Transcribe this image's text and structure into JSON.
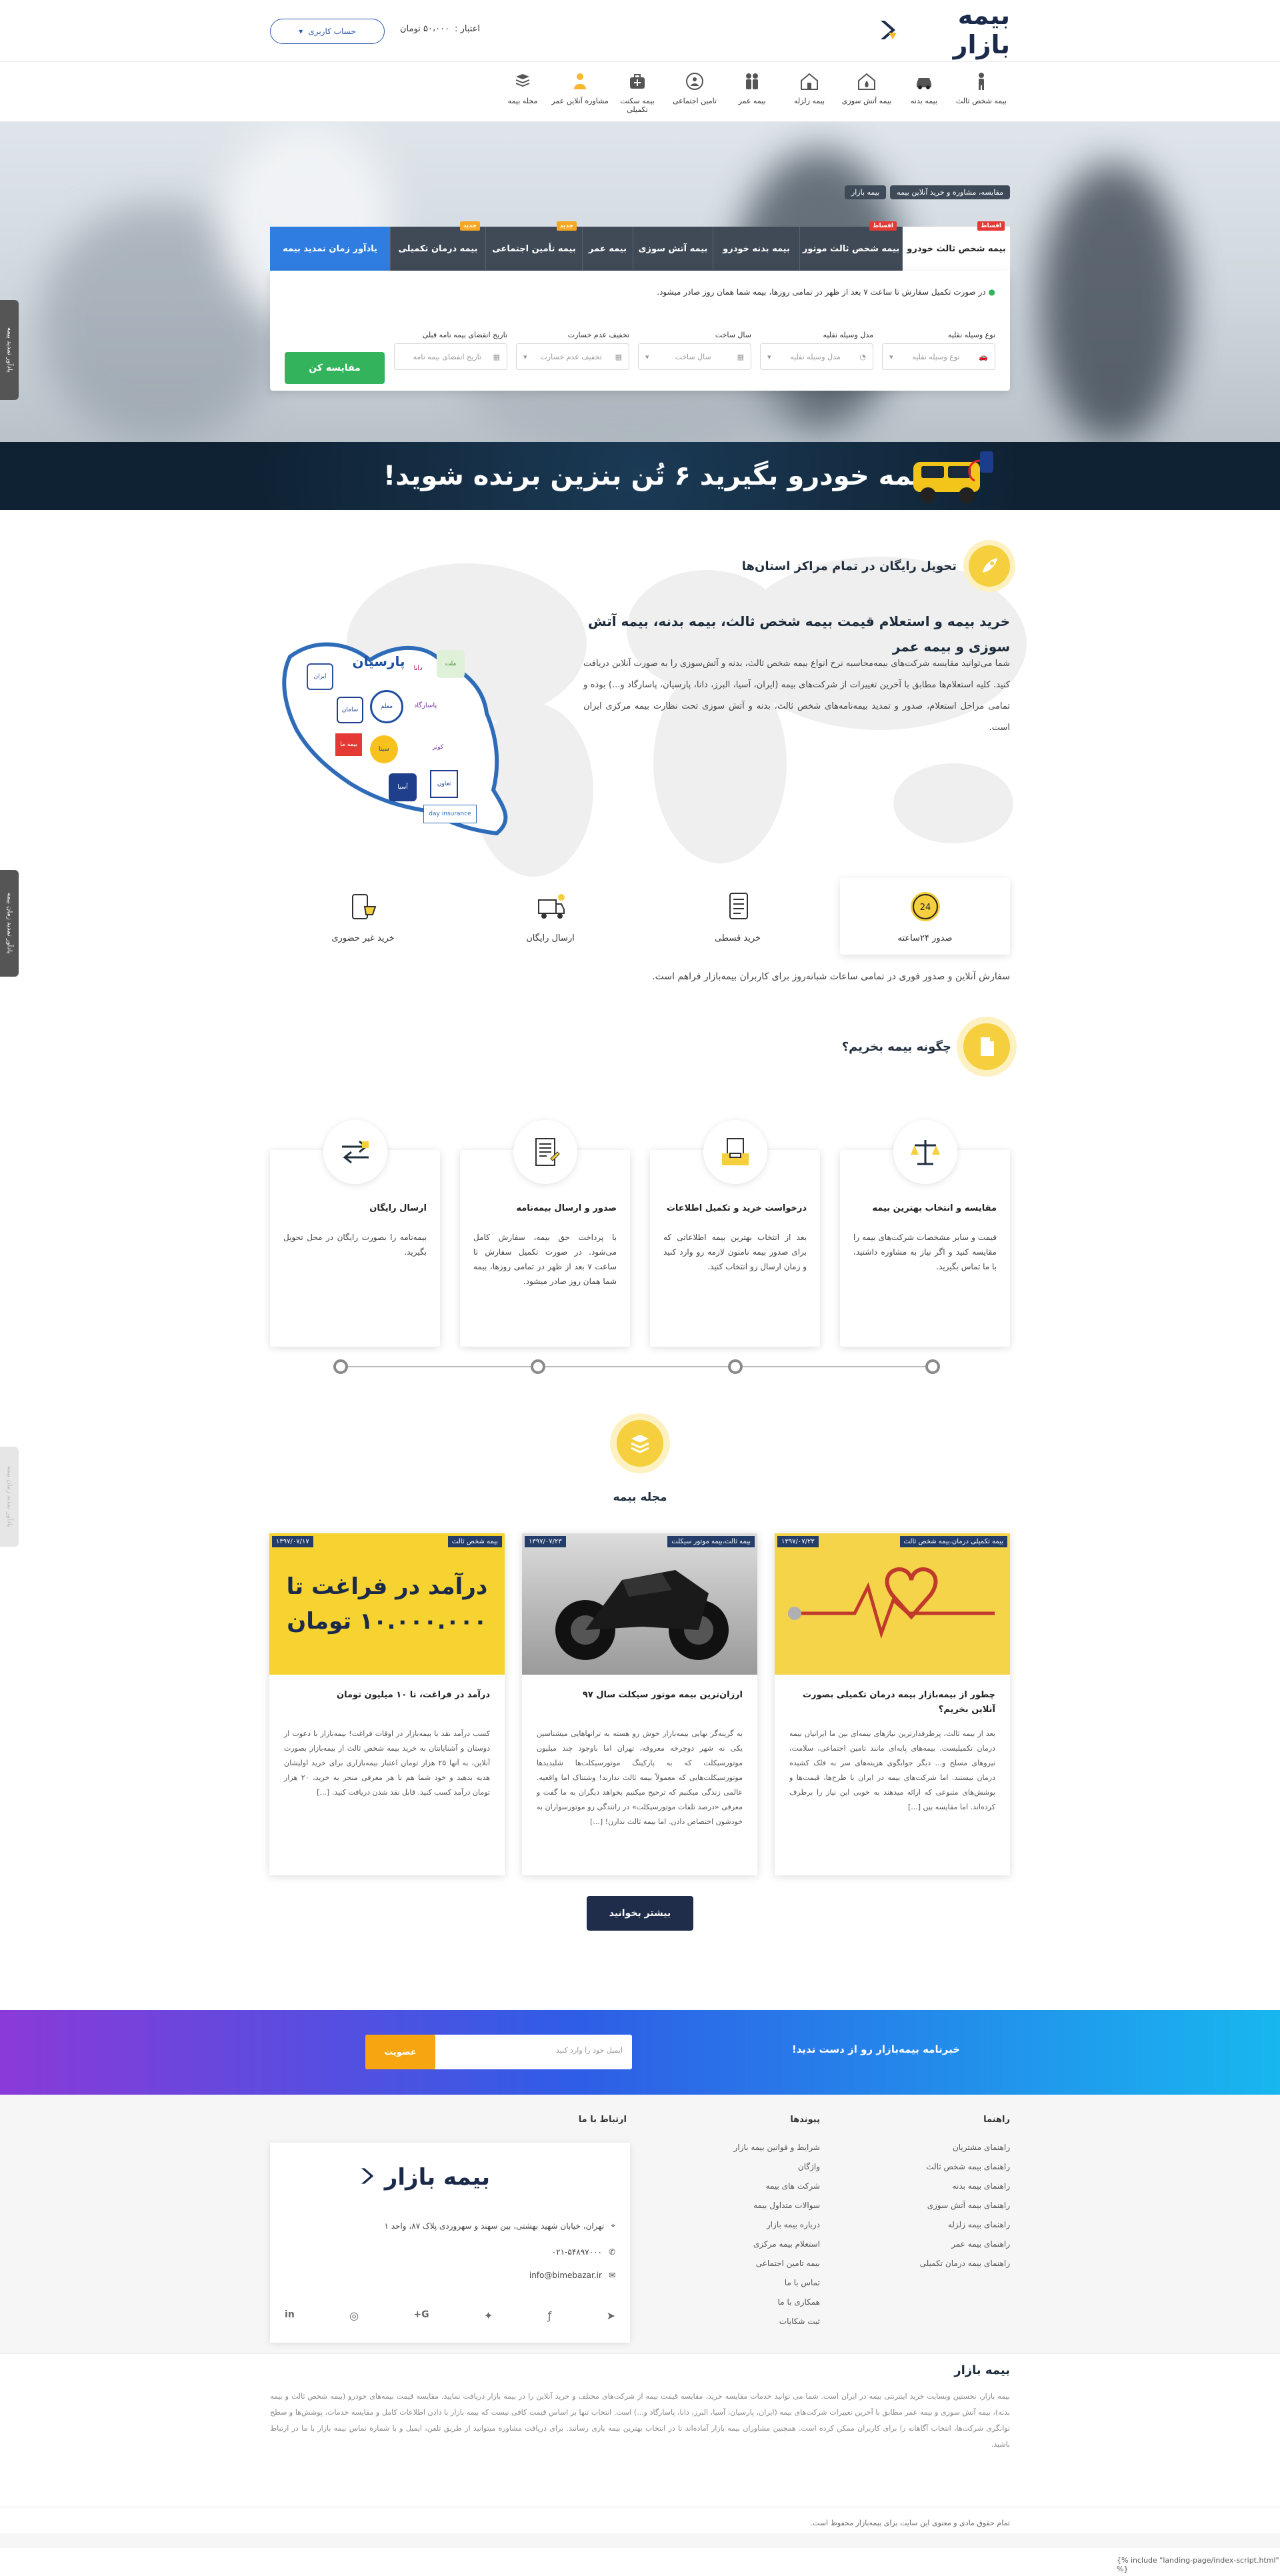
{
  "header": {
    "logo_text": "بیمه بازار",
    "account_label": "حساب کاربری",
    "credit_label": "اعتبار :",
    "credit_value": "۵۰،۰۰۰ تومان"
  },
  "nav": [
    {
      "label": "بیمه شخص ثالث",
      "icon": "person-icon"
    },
    {
      "label": "بیمه بدنه",
      "icon": "car-icon"
    },
    {
      "label": "بیمه آتش سوزی",
      "icon": "fire-home-icon"
    },
    {
      "label": "بیمه زلزله",
      "icon": "house-icon"
    },
    {
      "label": "بیمه عمر",
      "icon": "family-icon"
    },
    {
      "label": "تامین اجتماعی",
      "icon": "social-security-icon"
    },
    {
      "label": "بیمه سکنت تکمیلی",
      "icon": "medical-bag-icon"
    },
    {
      "label": "مشاوره آنلاین عمر",
      "icon": "consultant-icon"
    },
    {
      "label": "مجله بیمه",
      "icon": "magazine-icon"
    }
  ],
  "hero": {
    "breadcrumb": [
      "مقایسه، مشاوره و خرید آنلاین بیمه",
      "بیمه بازار"
    ],
    "tabs": [
      {
        "label": "بیمه شخص ثالث خودرو",
        "badge": "اقساط",
        "badge_color": "#e53935",
        "active": true
      },
      {
        "label": "بیمه شخص ثالث موتور",
        "badge": "اقساط",
        "badge_color": "#e53935"
      },
      {
        "label": "بیمه بدنه خودرو",
        "badge": ""
      },
      {
        "label": "بیمه آتش سوزی",
        "badge": ""
      },
      {
        "label": "بیمه عمر",
        "badge": ""
      },
      {
        "label": "بیمه تأمین اجتماعی",
        "badge": "جدید",
        "badge_color": "#f5a623"
      },
      {
        "label": "بیمه درمان تکمیلی",
        "badge": "جدید",
        "badge_color": "#f5a623"
      }
    ],
    "remind_tab": "یادآور زمان تمدید بیمه",
    "note": "در صورت تکمیل سفارش تا ساعت ۷ بعد از ظهر در تمامی روزها، بیمه شما همان روز صادر میشود.",
    "fields": [
      {
        "label": "نوع وسیله نقلیه",
        "placeholder": "نوع وسیله نقلیه"
      },
      {
        "label": "مدل وسیله نقلیه",
        "placeholder": "مدل وسیله نقلیه"
      },
      {
        "label": "سال ساخت",
        "placeholder": "سال ساخت"
      },
      {
        "label": "تخفیف عدم خسارت",
        "placeholder": "تخفیف عدم خسارت"
      },
      {
        "label": "تاریخ انقضای بیمه نامه قبلی",
        "placeholder": "تاریخ انقضای بیمه نامه"
      }
    ],
    "compare_button": "مقایسه کن"
  },
  "promo": {
    "text": "بیمه خودرو بگیرید ۶ تُن بنزین برنده شوید!"
  },
  "intro": {
    "delivery_title": "تحویل رایگان در تمام مراکز استان‌ها",
    "title": "خرید بیمه و استعلام قیمت بیمه شخص ثالث، بیمه بدنه، بیمه آتش سوزی و بیمه عمر",
    "body": "شما می‌توانید مقایسه شرکت‌های بیمه‌محاسبه نرخ انواع بیمه شخص ثالث، بدنه و آتش‌سوزی را به صورت آنلاین دریافت کنید. کلیه استعلام‌ها مطابق با آخرین تغییرات از شرکت‌های بیمه (ایران، آسیا، البرز، دانا، پارسیان، پاسارگاد و...) بوده و تمامی مراحل استعلام، صدور و تمدید بیمه‌نامه‌های شخص ثالث، بدنه و آتش سوزی تحت نظارت بیمه مرکزی ایران است.",
    "features": [
      {
        "label": "صدور ۲۴ساعته",
        "icon": "clock-24-icon"
      },
      {
        "label": "خرید قسطی",
        "icon": "installment-icon"
      },
      {
        "label": "ارسال رایگان",
        "icon": "delivery-icon"
      },
      {
        "label": "خرید غیر حضوری",
        "icon": "online-shop-icon"
      }
    ],
    "features_note": "سفارش آنلاین و صدور فوری در تمامی ساعات شبانه‌روز برای کاربران بیمه‌بازار فراهم است.",
    "insurer_logos": [
      "ایران",
      "سامان",
      "پارسیان",
      "دانا",
      "ملت",
      "معلم",
      "پاسارگاد",
      "بیمه ما",
      "سینا",
      "کوثر",
      "آسیا",
      "تعاون",
      "day insurance"
    ]
  },
  "how": {
    "title": "چگونه بیمه بخریم؟",
    "steps": [
      {
        "title": "مقایسه و انتخاب بهترین بیمه",
        "text": "قیمت و سایر مشخصات شرکت‌های بیمه را مقایسه کنید و اگر نیاز به مشاوره داشتید، با ما تماس بگیرید.",
        "icon": "scales-icon"
      },
      {
        "title": "درخواست خرید و تکمیل اطلاعات",
        "text": "بعد از انتخاب بهترین بیمه اطلاعاتی که برای صدور بیمه نامتون لازمه رو وارد کنید و زمان ارسال رو انتخاب کنید.",
        "icon": "document-box-icon"
      },
      {
        "title": "صدور و ارسال بیمه‌نامه",
        "text": "با پرداخت حق بیمه، سفارش کامل می‌شود. در صورت تکمیل سفارش تا ساعت ۷ بعد از ظهر در تمامی روزها، بیمه شما همان روز صادر میشود.",
        "icon": "contract-icon"
      },
      {
        "title": "ارسال رایگان",
        "text": "بیمه‌نامه را بصورت رایگان در محل تحویل بگیرید.",
        "icon": "transfer-icon"
      }
    ]
  },
  "mag": {
    "title": "مجله بیمه",
    "cards": [
      {
        "tag": "بیمه تکمیلی درمان،بیمه شخص ثالث",
        "date": "۱۳۹۷/۰۷/۲۳",
        "title": "چطور از بیمه‌بازار بیمه درمان تکمیلی بصورت آنلاین بخریم؟",
        "excerpt": "بعد از بیمه ثالث، پرطرفدارترین نیازهای بیمه‌ای بین ما ایرانیان بیمه درمان تکمیلیست. بیمه‌های پایه‌ای مانند تامین اجتماعی، سلامت، نیروهای مسلح و... دیگر جوابگوی هزینه‌های سر به فلک کشیده درمان نیستند. اما شرکت‌های بیمه در ایران با طرح‌ها، قیمت‌ها و پوشش‌های متنوعی که ارائه میدهند به خوبی این نیاز را برطرف کرده‌اند. اما مقایسه بین [...]"
      },
      {
        "tag": "بیمه ثالث،بیمه موتور سیکلت",
        "date": "۱۳۹۷/۰۷/۲۳",
        "title": "ارزان‌ترین بیمه موتور سیکلت سال ۹۷",
        "excerpt": "به گزینه‌گر نهایی بیمه‌بازار خوش رو هسته به ترانها‌هایی میشناسین یکی نه شهر دوچرخه معروفه، تهران اما باوجود چند میلیون موتورسیکلت که به پارکینگ موتورسیکلت‌ها شلیدیدها موتورسیکلت‌هایی که معمولاً بیمه ثالث ندارند! وشتناک اما واقعیه. عالمی زندگی میکنیم که ترجیح میکنیم بخواهد دیگران به ما گفت و معرفی «درصد تلفات موتورسیکلت» در رانندگی رو موتورسواران به خودشون اختصاص دادن. اما بیمه ثالث ندارن! [...]"
      },
      {
        "tag": "بیمه شخص ثالث",
        "date": "۱۳۹۷/۰۷/۱۷",
        "title": "درآمد در فراغت، تا ۱۰ میلیون تومان",
        "excerpt": "کسب درآمد نقد با بیمه‌بازار در اوقات فراغت! بیمه‌بازار با دعوت از دوستان و آشنایانتان به خرید بیمه شخص ثالث از بیمه‌بازار بصورت آنلاین، به آنها ۲۵ هزار تومان اعتبار بیمه‌بازاری برای خرید اولیشان هدیه بدهید و خود شما هم با هر معرفی منجر به خرید، ۲۰ هزار تومان درآمد کسب کنید. قابل نقد شدن دریافت کنید. [...]",
        "image_text": "درآمد در فراغت تا ۱۰.۰۰۰.۰۰۰ تومان"
      }
    ],
    "more_button": "بیشتر بخوانید"
  },
  "newsletter": {
    "title": "خبرنامه بیمه‌بازار رو از دست ندید!",
    "placeholder": "ایمیل خود را وارد کنید",
    "button": "عضویت"
  },
  "footer": {
    "guides_title": "راهنما",
    "guides": [
      "راهنمای مشتریان",
      "راهنمای بیمه شخص ثالث",
      "راهنمای بیمه بدنه",
      "راهنمای بیمه آتش سوزی",
      "راهنمای بیمه زلزله",
      "راهنمای بیمه عمر",
      "راهنمای بیمه درمان تکمیلی"
    ],
    "links_title": "پیوندها",
    "links": [
      "شرایط و قوانین بیمه بازار",
      "واژگان",
      "شرکت های بیمه",
      "سوالات متداول بیمه",
      "درباره بیمه بازار",
      "استعلام بیمه مرکزی",
      "بیمه تامین اجتماعی",
      "تماس با ما",
      "همکاری با ما",
      "ثبت شکایات"
    ],
    "contact_title": "ارتباط با ما",
    "contact_logo": "بیمه بازار",
    "address": "تهران، خیابان شهید بهشتی، بین سهند و سهروردی پلاک ۸۷، واحد ۱",
    "phone": "۰۲۱-۵۴۸۹۷۰۰۰",
    "email": "info@bimebazar.ir",
    "about_title": "بیمه بازار",
    "about_text": "بیمه بازار، نخستین وبسایت خرید اینترنتی بیمه در ایران است. شما می توانید خدمات مقایسه خرید، مقایسه قیمت بیمه از شرکت‌های مختلف و خرید آنلاین را در بیمه بازار دریافت نمایید. مقایسه قیمت بیمه‌های خودرو (بیمه شخص ثالث و بیمه بدنه)، بیمه آتش سوزی و بیمه عمر مطابق با آخرین تغییرات شرکت‌های بیمه (ایران، پارسیان، آسیا، البرز، دانا، پاسارگاد و...) است. انتخاب تنها بر اساس قیمت کافی نیست که بیمه بازار با دادن اطلاعات کامل و مقایسه خدمات، پوشش‌ها و سطح توانگری شرکت‌ها، انتخاب آگاهانه را برای کاربران ممکن کرده است. همچنین مشاوران بیمه بازار آماده‌اند تا در انتخاب بهترین بیمه یاری رسانند. برای دریافت مشاوره میتوانید از طریق تلفن، ایمیل و با شماره تماس بیمه بازار با ما در ارتباط باشید.",
    "copyright": "تمام حقوق مادی و معنوی این سایت برای بیمه‌بازار محفوظ است."
  },
  "side_tabs": {
    "top": "یادآور تمدید بیمه",
    "middle": "یادآور تمدید زمان بیمه",
    "bottom": "یادآور تمدید زمان بیمه"
  },
  "twig_include": "{% include \"landing-page/index-script.html\" %}",
  "colors": {
    "brand_navy": "#1b2a4a",
    "accent_yellow": "#f5cf3d",
    "compare_green": "#33b35c",
    "remind_blue": "#2f7de1",
    "newsletter_orange": "#f7a611"
  }
}
